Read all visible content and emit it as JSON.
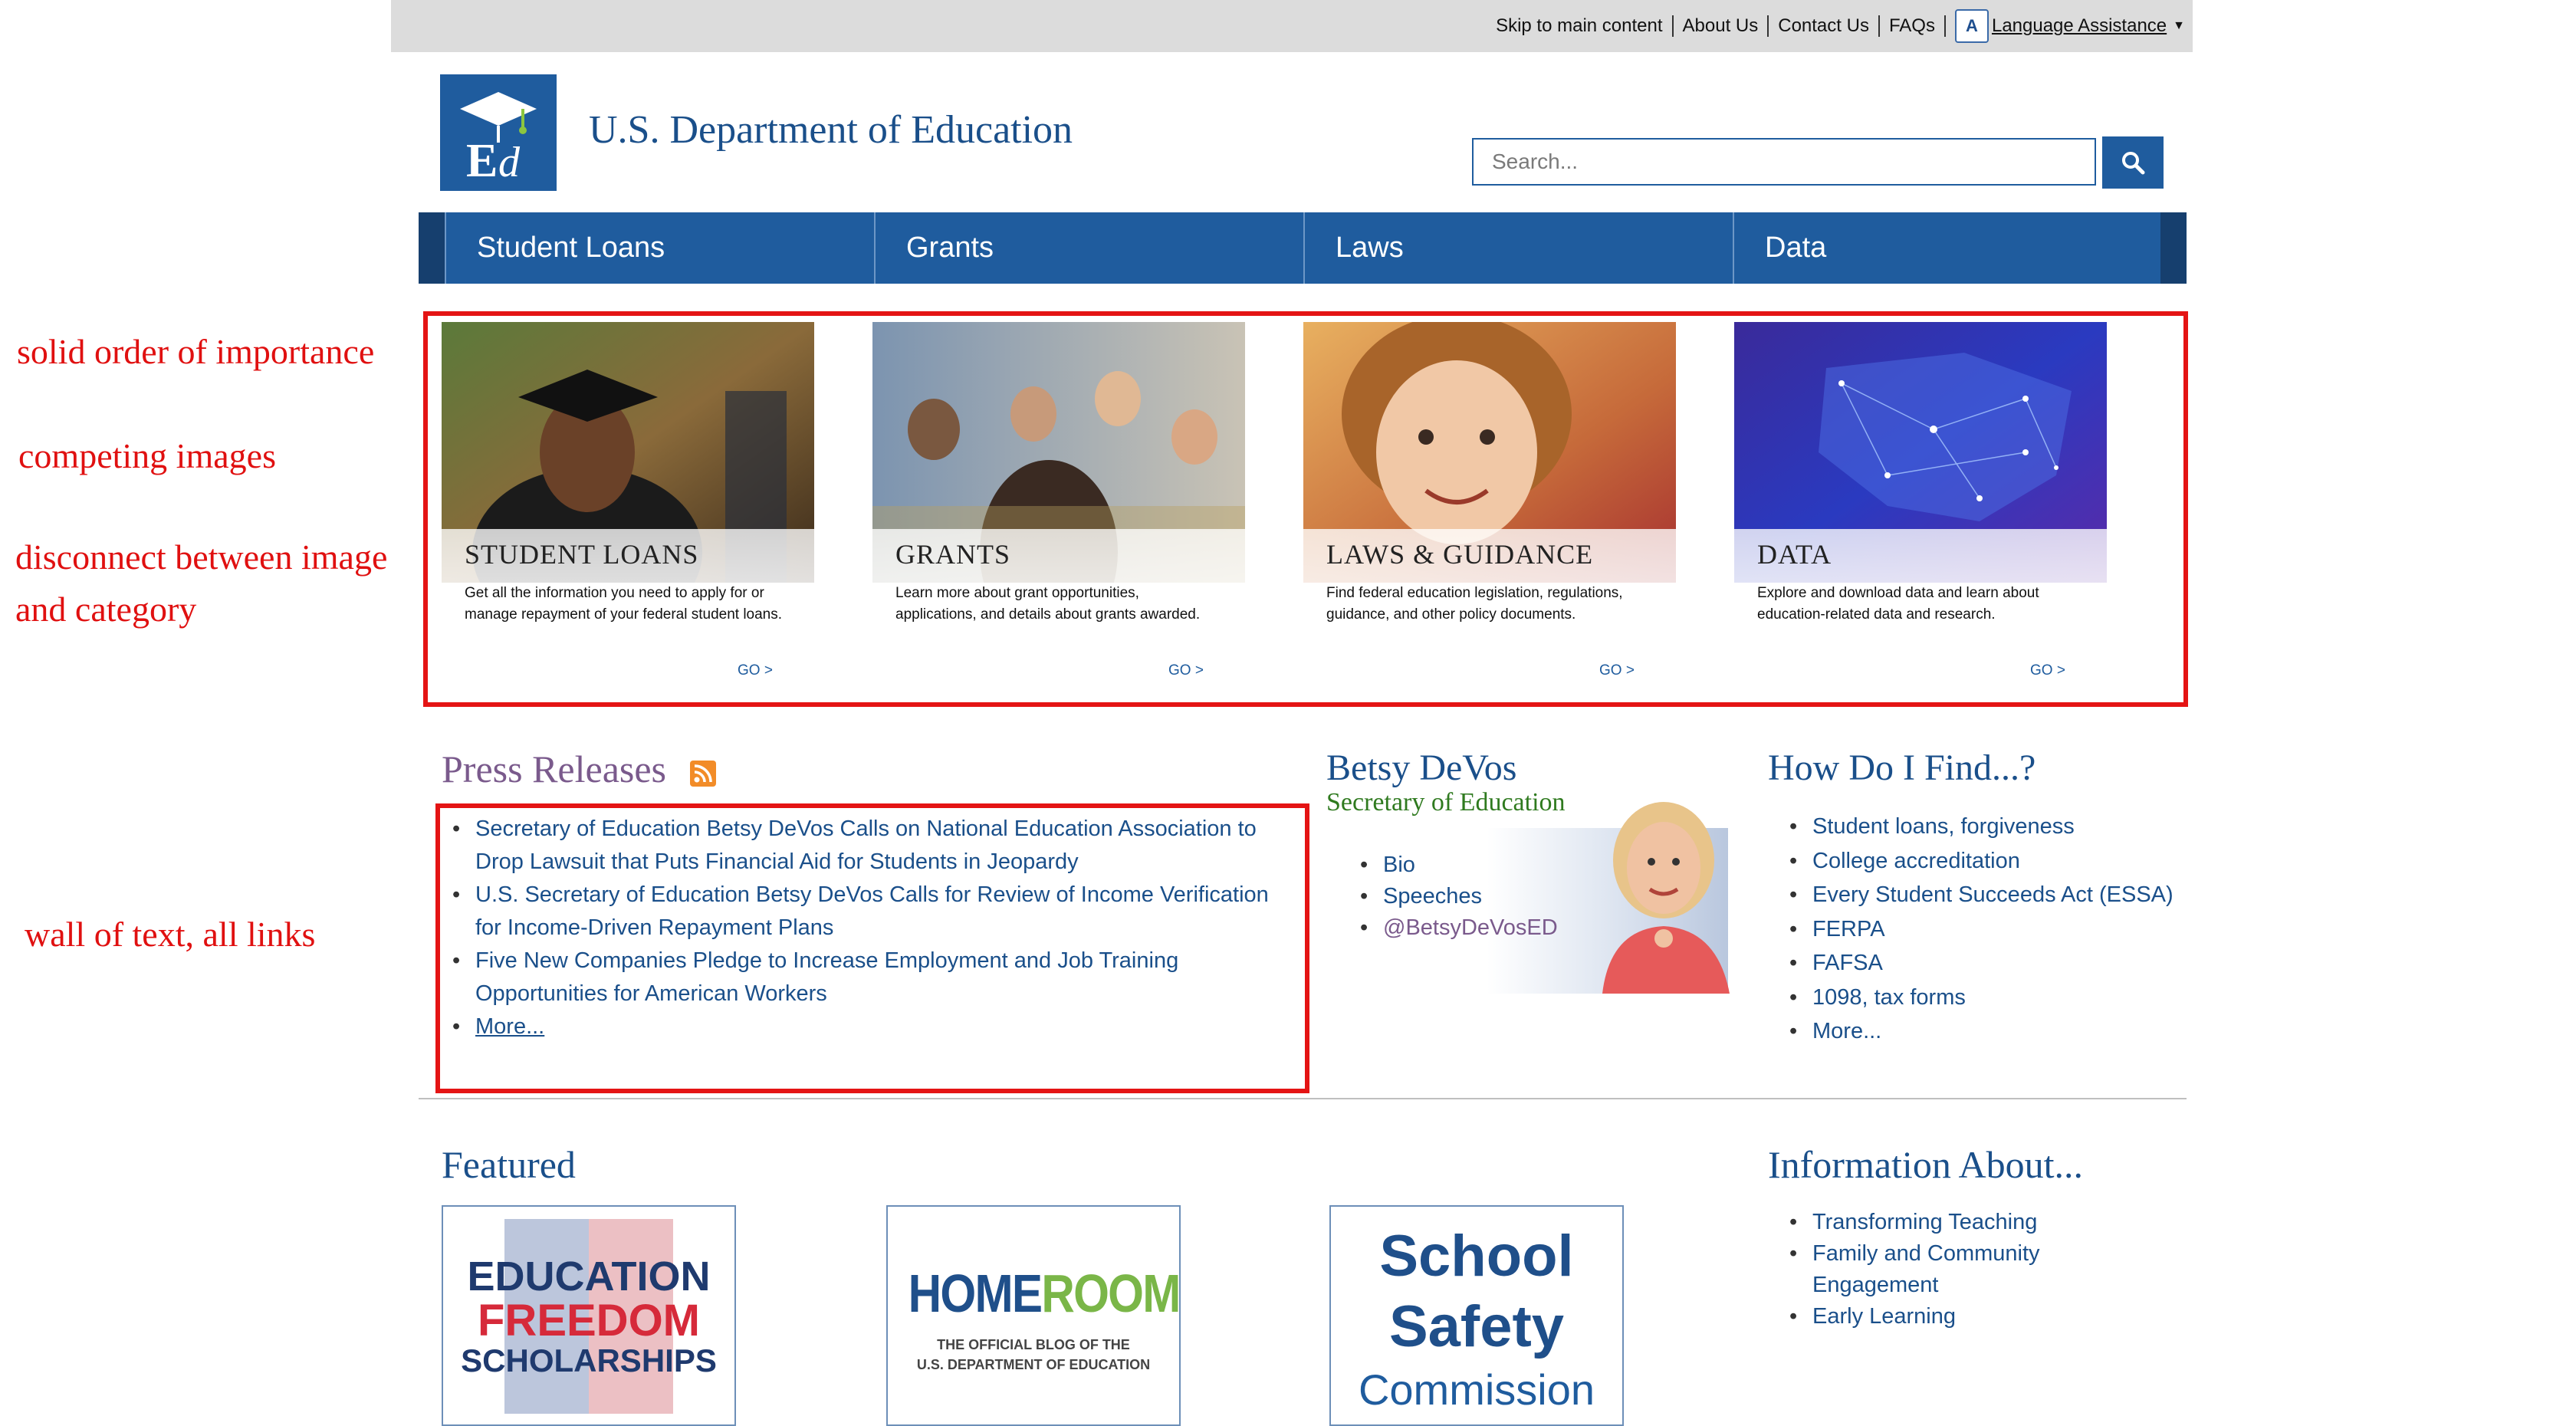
{
  "util_bar": {
    "links": [
      "Skip to main content",
      "About Us",
      "Contact Us",
      "FAQs"
    ],
    "language": "Language Assistance",
    "language_icon": "language-icon"
  },
  "header": {
    "title": "U.S. Department of Education",
    "logo_icon": "ed-logo-icon",
    "search_placeholder": "Search...",
    "search_icon": "search-icon"
  },
  "nav": {
    "items": [
      "Student Loans",
      "Grants",
      "Laws",
      "Data"
    ]
  },
  "annotations": {
    "order": "solid order of importance",
    "images": "competing images",
    "disconnect_1": "disconnect between image",
    "disconnect_2": "and category",
    "wall": "wall of text, all links"
  },
  "cards": [
    {
      "title": "STUDENT LOANS",
      "desc": "Get all the information you need to apply for or manage repayment of your federal student loans.",
      "go": "GO >"
    },
    {
      "title": "GRANTS",
      "desc": "Learn more about grant opportunities, applications, and details about grants awarded.",
      "go": "GO >"
    },
    {
      "title": "LAWS & GUIDANCE",
      "desc": "Find federal education legislation, regulations, guidance, and other policy documents.",
      "go": "GO >"
    },
    {
      "title": "DATA",
      "desc": "Explore and download data and learn about education-related data and research.",
      "go": "GO >"
    }
  ],
  "press": {
    "title": "Press Releases",
    "rss_icon": "rss-icon",
    "items": [
      "Secretary of Education Betsy DeVos Calls on National Education Association to Drop Lawsuit that Puts Financial Aid for Students in Jeopardy",
      "U.S. Secretary of Education Betsy DeVos Calls for Review of Income Verification for Income-Driven Repayment Plans",
      "Five New Companies Pledge to Increase Employment and Job Training Opportunities for American Workers"
    ],
    "more": "More..."
  },
  "secretary": {
    "name": "Betsy DeVos",
    "role": "Secretary of Education",
    "links": [
      "Bio",
      "Speeches",
      "@BetsyDeVosED"
    ]
  },
  "howfind": {
    "title": "How Do I Find...?",
    "items": [
      "Student loans, forgiveness",
      "College accreditation",
      "Every Student Succeeds Act (ESSA)",
      "FERPA",
      "FAFSA",
      "1098, tax forms",
      "More..."
    ]
  },
  "featured": {
    "title": "Featured",
    "efs": {
      "l1": "EDUCATION",
      "l2": "FREEDOM",
      "l3": "SCHOLARSHIPS"
    },
    "homeroom": {
      "home": "HOME",
      "room": "ROOM",
      "sub1": "THE OFFICIAL BLOG OF THE",
      "sub2": "U.S. DEPARTMENT OF EDUCATION"
    },
    "safety": {
      "l1": "School",
      "l2": "Safety",
      "l3": "Commission"
    }
  },
  "info": {
    "title": "Information About...",
    "items": [
      "Transforming Teaching",
      "Family and Community Engagement",
      "Early Learning"
    ]
  },
  "colors": {
    "brand_blue": "#1f5c9e",
    "annotation_red": "#e41414",
    "press_title": "#7a5a8c",
    "secretary_role": "#2f7a1f"
  }
}
